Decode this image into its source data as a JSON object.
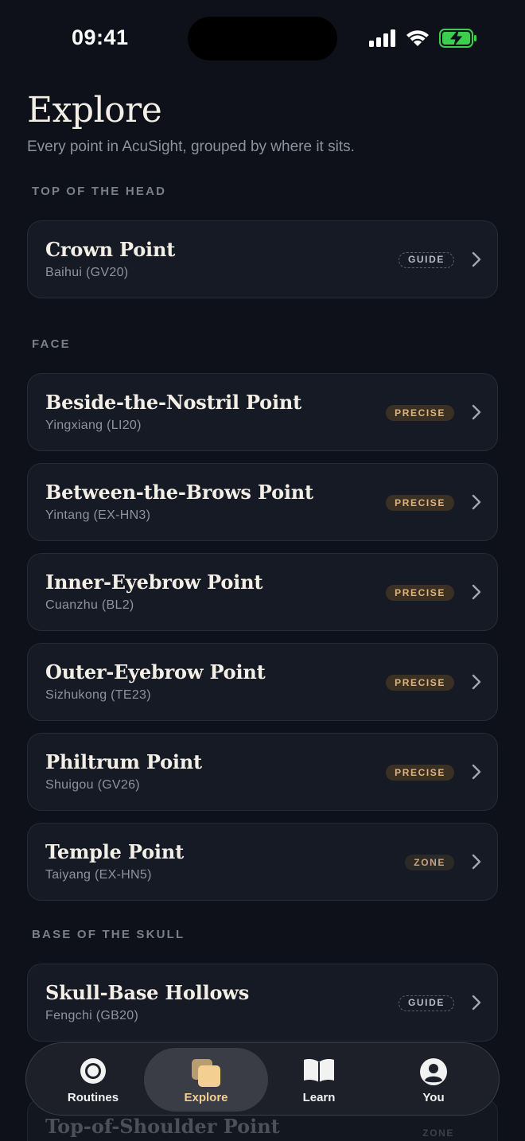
{
  "status_bar": {
    "time": "09:41"
  },
  "header": {
    "title": "Explore",
    "subtitle": "Every point in AcuSight, grouped by where it sits."
  },
  "sections": [
    {
      "title": "TOP OF THE HEAD",
      "points": [
        {
          "name": "Crown Point",
          "sub": "Baihui (GV20)",
          "badge": "GUIDE"
        }
      ]
    },
    {
      "title": "FACE",
      "points": [
        {
          "name": "Beside-the-Nostril Point",
          "sub": "Yingxiang (LI20)",
          "badge": "PRECISE"
        },
        {
          "name": "Between-the-Brows Point",
          "sub": "Yintang (EX-HN3)",
          "badge": "PRECISE"
        },
        {
          "name": "Inner-Eyebrow Point",
          "sub": "Cuanzhu (BL2)",
          "badge": "PRECISE"
        },
        {
          "name": "Outer-Eyebrow Point",
          "sub": "Sizhukong (TE23)",
          "badge": "PRECISE"
        },
        {
          "name": "Philtrum Point",
          "sub": "Shuigou (GV26)",
          "badge": "PRECISE"
        },
        {
          "name": "Temple Point",
          "sub": "Taiyang (EX-HN5)",
          "badge": "ZONE"
        }
      ]
    },
    {
      "title": "BASE OF THE SKULL",
      "points": [
        {
          "name": "Skull-Base Hollows",
          "sub": "Fengchi (GB20)",
          "badge": "GUIDE"
        }
      ]
    }
  ],
  "peek_item": {
    "name": "Top-of-Shoulder Point",
    "badge": "ZONE"
  },
  "tabbar": {
    "tabs": [
      {
        "label": "Routines",
        "icon": "target-icon"
      },
      {
        "label": "Explore",
        "icon": "stacked-cards-icon",
        "active": true
      },
      {
        "label": "Learn",
        "icon": "book-icon"
      },
      {
        "label": "You",
        "icon": "user-circle-icon"
      }
    ]
  },
  "colors": {
    "background": "#0e111a",
    "accent": "#f3cf92",
    "precise_badge": "#e0b37c",
    "battery": "#3ccf4e"
  }
}
